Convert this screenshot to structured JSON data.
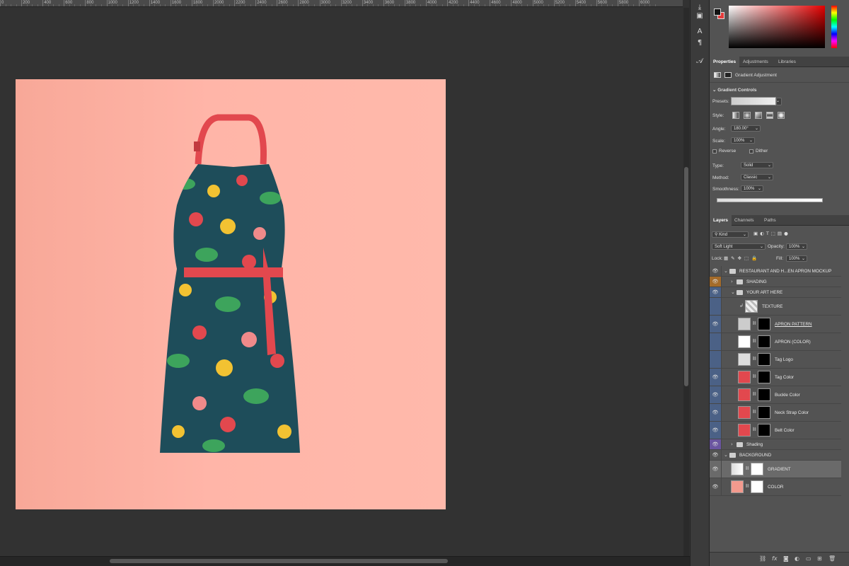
{
  "ruler": {
    "marks": [
      "0",
      "200",
      "400",
      "600",
      "800",
      "1000",
      "1200",
      "1400",
      "1600",
      "1800",
      "2000",
      "2200",
      "2400",
      "2600",
      "2800",
      "3000",
      "3200",
      "3400",
      "3600",
      "3800",
      "4000",
      "4200",
      "4400",
      "4600",
      "4800",
      "5000",
      "5200",
      "5400",
      "5600",
      "5800",
      "6000"
    ]
  },
  "tools": [
    "transform-icon",
    "comment-icon",
    "character-icon",
    "paragraph-icon",
    "glyphs-icon"
  ],
  "colors": {
    "foreground": "#111111",
    "background": "#e43c3c",
    "canvas_bg": "#323232",
    "panel": "#535353",
    "accent_red": "#e2484e"
  },
  "properties": {
    "tabs": [
      {
        "label": "Properties"
      },
      {
        "label": "Adjustments"
      },
      {
        "label": "Libraries"
      }
    ],
    "adjustment_label": "Gradient Adjustment",
    "section_title": "Gradient Controls",
    "presets_label": "Presets:",
    "style_label": "Style:",
    "angle_label": "Angle:",
    "angle_value": "180.00°",
    "scale_label": "Scale:",
    "scale_value": "100%",
    "reverse_label": "Reverse",
    "dither_label": "Dither",
    "type_label": "Type:",
    "type_value": "Solid",
    "method_label": "Method:",
    "method_value": "Classic",
    "smoothness_label": "Smoothness:",
    "smoothness_value": "100%"
  },
  "layers_panel": {
    "tabs": [
      {
        "label": "Layers"
      },
      {
        "label": "Channels"
      },
      {
        "label": "Paths"
      }
    ],
    "kind_value": "Kind",
    "blend_mode": "Soft Light",
    "opacity_label": "Opacity:",
    "opacity_value": "100%",
    "lock_label": "Lock:",
    "fill_label": "Fill:",
    "fill_value": "100%",
    "layers": [
      {
        "name": "RESTAURANT AND H...EN APRON MOCKUP",
        "kind": "group",
        "indent": 0
      },
      {
        "name": "SHADING",
        "kind": "group",
        "indent": 1,
        "collapsed": true
      },
      {
        "name": "YOUR ART HERE",
        "kind": "group",
        "indent": 1
      },
      {
        "name": "TEXTURE",
        "kind": "layer",
        "indent": 2
      },
      {
        "name": "APRON PATTERN",
        "kind": "layer",
        "indent": 2
      },
      {
        "name": "APRON (COLOR)",
        "kind": "layer",
        "indent": 2
      },
      {
        "name": "Tag Logo",
        "kind": "layer",
        "indent": 2
      },
      {
        "name": "Tag Color",
        "kind": "layer",
        "indent": 2
      },
      {
        "name": "Buckle Color",
        "kind": "layer",
        "indent": 2
      },
      {
        "name": "Neck Strap Color",
        "kind": "layer",
        "indent": 2
      },
      {
        "name": "Belt Color",
        "kind": "layer",
        "indent": 2
      },
      {
        "name": "Shading",
        "kind": "group",
        "indent": 1,
        "collapsed": true
      },
      {
        "name": "BACKGROUND",
        "kind": "group",
        "indent": 0
      },
      {
        "name": "GRADIENT",
        "kind": "layer",
        "indent": 1,
        "selected": true
      },
      {
        "name": "COLOR",
        "kind": "layer",
        "indent": 1
      }
    ]
  },
  "footer_icons": [
    "link-icon",
    "fx-icon",
    "mask-icon",
    "adjustment-icon",
    "group-icon",
    "new-layer-icon",
    "trash-icon"
  ]
}
